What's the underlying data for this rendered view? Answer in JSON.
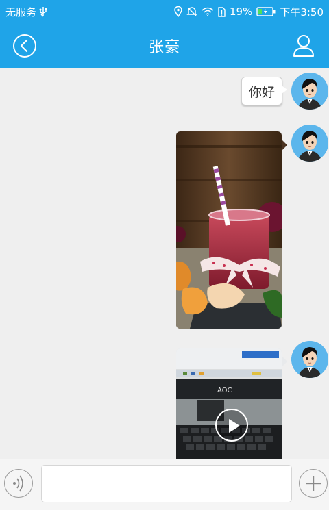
{
  "status_bar": {
    "carrier": "无服务",
    "battery_percent": "19%",
    "time": "下午3:50",
    "icons": [
      "usb-icon",
      "location-icon",
      "silent-icon",
      "wifi-icon",
      "sim-icon",
      "battery-icon"
    ]
  },
  "header": {
    "title": "张豪",
    "back_icon": "back-circle-icon",
    "contact_icon": "person-icon"
  },
  "messages": [
    {
      "type": "text",
      "sender": "self",
      "text": "你好"
    },
    {
      "type": "image",
      "sender": "self"
    },
    {
      "type": "video",
      "sender": "self",
      "monitor_brand": "AOC"
    }
  ],
  "input_bar": {
    "voice_icon": "voice-icon",
    "input_value": "",
    "plus_icon": "plus-icon"
  },
  "colors": {
    "accent": "#1fa4e8",
    "background": "#efefef",
    "avatar_bg": "#5cb6ec"
  }
}
